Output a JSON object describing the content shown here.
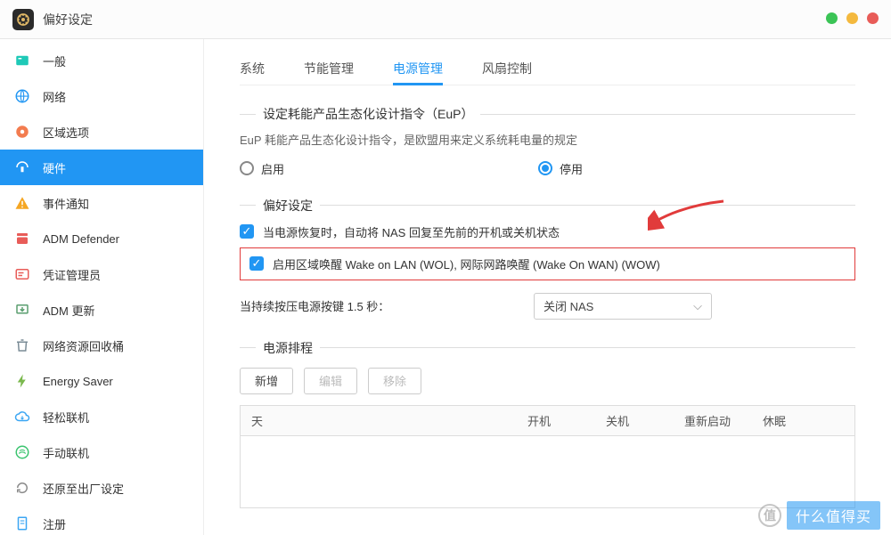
{
  "window": {
    "title": "偏好设定"
  },
  "traffic": {
    "green": "#3bc456",
    "yellow": "#f4b93e",
    "red": "#e85c58"
  },
  "sidebar": {
    "items": [
      {
        "label": "一般",
        "icon_color": "#1ec9b7",
        "icon": "general"
      },
      {
        "label": "网络",
        "icon_color": "#2196f3",
        "icon": "globe"
      },
      {
        "label": "区域选项",
        "icon_color": "#f37c4f",
        "icon": "region"
      },
      {
        "label": "硬件",
        "icon_color": "#ffffff",
        "icon": "hardware",
        "active": true
      },
      {
        "label": "事件通知",
        "icon_color": "#f5a623",
        "icon": "alert"
      },
      {
        "label": "ADM Defender",
        "icon_color": "#e85c58",
        "icon": "defender"
      },
      {
        "label": "凭证管理员",
        "icon_color": "#e85c58",
        "icon": "cert"
      },
      {
        "label": "ADM 更新",
        "icon_color": "#5a9e6f",
        "icon": "update"
      },
      {
        "label": "网络资源回收桶",
        "icon_color": "#7a8b96",
        "icon": "trash"
      },
      {
        "label": "Energy Saver",
        "icon_color": "#7ab84d",
        "icon": "energy"
      },
      {
        "label": "轻松联机",
        "icon_color": "#3ba6f3",
        "icon": "cloud"
      },
      {
        "label": "手动联机",
        "icon_color": "#3bc46f",
        "icon": "manual"
      },
      {
        "label": "还原至出厂设定",
        "icon_color": "#8a8a8a",
        "icon": "reset"
      },
      {
        "label": "注册",
        "icon_color": "#3ba6f3",
        "icon": "register"
      }
    ]
  },
  "tabs": [
    {
      "label": "系统"
    },
    {
      "label": "节能管理"
    },
    {
      "label": "电源管理",
      "active": true
    },
    {
      "label": "风扇控制"
    }
  ],
  "eup": {
    "title": "设定耗能产品生态化设计指令（EuP）",
    "desc": "EuP 耗能产品生态化设计指令，是欧盟用来定义系统耗电量的规定",
    "opt_enable": "启用",
    "opt_disable": "停用"
  },
  "prefs": {
    "title": "偏好设定",
    "check1": "当电源恢复时，自动将 NAS 回复至先前的开机或关机状态",
    "check2": "启用区域唤醒 Wake on LAN  (WOL), 网际网路唤醒 (Wake On WAN) (WOW)",
    "press_label": "当持续按压电源按键 1.5 秒：",
    "press_value": "关闭 NAS"
  },
  "schedule": {
    "title": "电源排程",
    "add": "新增",
    "edit": "编辑",
    "remove": "移除",
    "cols": {
      "day": "天",
      "on": "开机",
      "off": "关机",
      "restart": "重新启动",
      "sleep": "休眠"
    }
  },
  "watermark": "什么值得买"
}
